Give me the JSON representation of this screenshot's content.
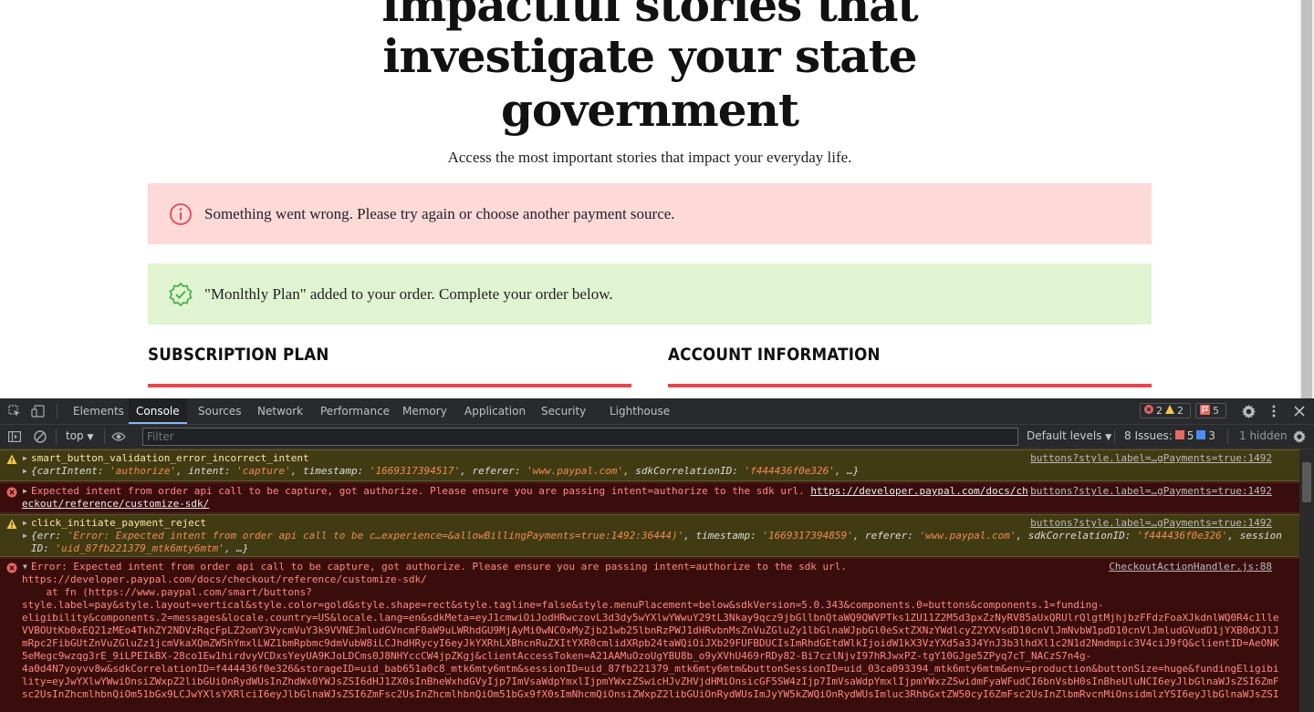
{
  "page": {
    "hero_lines": [
      "impactful stories that",
      "investigate your state",
      "government"
    ],
    "subtitle": "Access the most important stories that impact your everyday life.",
    "error_alert": "Something went wrong. Please try again or choose another payment source.",
    "success_alert": "\"Monlthly Plan\" added to your order. Complete your order below.",
    "section_subscription": "SUBSCRIPTION PLAN",
    "section_account": "ACCOUNT INFORMATION",
    "accent_color": "#e8454a"
  },
  "devtools": {
    "tabs": [
      "Elements",
      "Console",
      "Sources",
      "Network",
      "Performance",
      "Memory",
      "Application",
      "Security",
      "Lighthouse"
    ],
    "active_tab": "Console",
    "error_count": "2",
    "warning_count": "2",
    "issue_count": "5",
    "context": "top",
    "filter_placeholder": "Filter",
    "default_levels": "Default levels",
    "issues_label": "8 Issues:",
    "issues_errors": "5",
    "issues_info": "3",
    "hidden_label": "1 hidden"
  },
  "console": {
    "msg1": {
      "title": "smart_button_validation_error_incorrect_intent",
      "source": "buttons?style.label=…gPayments=true:1492",
      "obj_prefix": "{cartIntent: ",
      "cartIntent": "'authorize'",
      "k_intent": ", intent: ",
      "intent": "'capture'",
      "k_timestamp": ", timestamp: ",
      "timestamp": "'1669317394517'",
      "k_referer": ", referer: ",
      "referer": "'www.paypal.com'",
      "k_sdk": ", sdkCorrelationID: ",
      "sdk": "'f444436f0e326'",
      "suffix": ", …}"
    },
    "msg2": {
      "text": "Expected intent from order api call to be capture, got authorize. Please ensure you are passing intent=authorize to the sdk url. ",
      "link1": "https://developer.paypal.com/docs/ch",
      "link2": "eckout/reference/customize-sdk/",
      "source": "buttons?style.label=…gPayments=true:1492"
    },
    "msg3": {
      "title": "click_initiate_payment_reject",
      "source": "buttons?style.label=…gPayments=true:1492",
      "obj_prefix": "{err: ",
      "err": "'Error: Expected intent from order api call to be c…experience=&allowBillingPayments=true:1492:36444)'",
      "k_timestamp": ", timestamp: ",
      "timestamp": "'1669317394859'",
      "k_referer": ", referer: ",
      "referer": "'www.paypal.com'",
      "k_sdk": ", sdkCorrelationID: ",
      "sdk": "'f444436f0e326'",
      "k_session": ", session",
      "line2_key": "ID: ",
      "session": "'uid_87fb221379_mtk6mty6mtm'",
      "line2_suffix": ", …}"
    },
    "msg4": {
      "source": "CheckoutActionHandler.js:88",
      "lines": [
        "Error: Expected intent from order api call to be capture, got authorize. Please ensure you are passing intent=authorize to the sdk url.",
        "https://developer.paypal.com/docs/checkout/reference/customize-sdk/",
        "    at fn (https://www.paypal.com/smart/buttons?",
        "style.label=pay&style.layout=vertical&style.color=gold&style.shape=rect&style.tagline=false&style.menuPlacement=below&sdkVersion=5.0.343&components.0=buttons&components.1=funding-",
        "eligibility&components.2=messages&locale.country=US&locale.lang=en&sdkMeta=eyJ1cmwiOiJodHRwczovL3d3dy5wYXlwYWwuY29tL3Nkay9qcz9jbGllbnQtaWQ9QWVPTks1ZU11Z2M5d3pxZzNyRV85aUxQRUlrQlgtMjhjbzFFdzFoaXJkdnlWQ0R4c1lle",
        "VVBOUtKb0xEQ21zMEo4TkhZY2NDVzRqcFpLZ2omY3VycmVuY3k9VVNEJmludGVncmF0aW9uLWRhdGU9MjAyMi0wNC0xMyZjb21wb25lbnRzPWJ1dHRvbnMsZnVuZGluZy1lbGlnaWJpbGl0eSxtZXNzYWdlcyZ2YXVsdD10cnVlJmNvbW1pdD10cnVlJmludGVudD1jYXB0dXJlJ",
        "mRpc2FibGUtZnVuZGluZz1jcmVkaXQmZW5hYmxlLWZ1bmRpbmc9dmVubW8iLCJhdHRycyI6eyJkYXRhLXBhcnRuZXItYXR0cmlidXRpb24taWQiOiJXb29FUFBDUCIsImRhdGEtdWlkIjoidW1kX3VzYXd5a3J4YnJ3b3lhdXl1c2N1d2Nmdmpic3V4ciJ9fQ&clientID=AeONK",
        "5eMegc9wzqg3rE_9iLPEIkBX-28co1Ew1hirdvyVCDxsYeyUA9KJoLDCms0J8NHYccCW4jpZKgj&clientAccessToken=A21AAMuOzoUgYBU8b_o9yXVhU469rRDy82-Bi7czlNjvI97hRJwxPZ-tgY10GJge5ZPyq7cT_NACzS7n4g-",
        "4a0d4N7yoyvv8w&sdkCorrelationID=f444436f0e326&storageID=uid_bab651a0c8_mtk6mty6mtm&sessionID=uid_87fb221379_mtk6mty6mtm&buttonSessionID=uid_03ca093394_mtk6mty6mtm&env=production&buttonSize=huge&fundingEligibi",
        "lity=eyJwYXlwYWwiOnsiZWxpZ2libGUiOnRydWUsInZhdWx0YWJsZSI6dHJ1ZX0sInBheWxhdGVyIjp7ImVsaWdpYmxlIjpmYWxzZSwicHJvZHVjdHMiOnsicGF5SW4zIjp7ImVsaWdpYmxlIjpmYWxzZSwidmFyaWFudCI6bnVsbH0sInBheUluNCI6eyJlbGlnaWJsZSI6ZmF",
        "sc2UsInZhcmlhbnQiOm51bGx9LCJwYXlsYXRlciI6eyJlbGlnaWJsZSI6ZmFsc2UsInZhcmlhbnQiOm51bGx9fX0sImNhcmQiOnsiZWxpZ2libGUiOnRydWUsImJyYW5kZWQiOnRydWUsImluc3RhbGxtZW50cyI6ZmFsc2UsInZlbmRvcnMiOnsidmlzYSI6eyJlbGlnaWJsZSI"
      ]
    }
  }
}
